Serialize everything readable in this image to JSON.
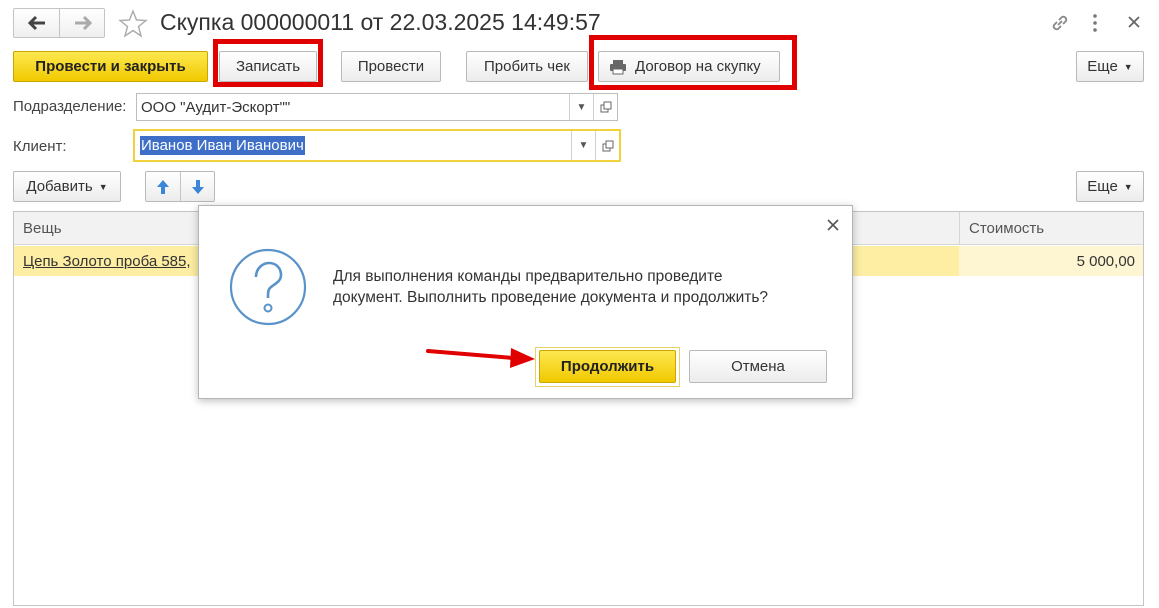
{
  "window": {
    "title": "Скупка 000000011 от 22.03.2025 14:49:57"
  },
  "nav": {
    "back_icon": "arrow-left-icon",
    "forward_icon": "arrow-right-icon",
    "favorite_icon": "star-icon",
    "link_icon": "link-icon",
    "menu_icon": "more-vertical-icon",
    "close_icon": "close-icon"
  },
  "toolbar": {
    "post_close_label": "Провести и закрыть",
    "save_label": "Записать",
    "post_label": "Провести",
    "receipt_label": "Пробить чек",
    "contract_label": "Договор на скупку",
    "more_label": "Еще"
  },
  "form": {
    "division_label": "Подразделение:",
    "division_value": "ООО \"Аудит-Эскорт\"\"",
    "client_label": "Клиент:",
    "client_value": "Иванов Иван Иванович"
  },
  "table_toolbar": {
    "add_label": "Добавить",
    "more_label": "Еще"
  },
  "table": {
    "columns": [
      "Вещь",
      "Стоимость"
    ],
    "rows": [
      {
        "item": "Цепь Золото проба 585,",
        "cost": "5 000,00"
      }
    ]
  },
  "dialog": {
    "message_line1": "Для выполнения команды предварительно проведите",
    "message_line2": "документ. Выполнить проведение документа и продолжить?",
    "continue_label": "Продолжить",
    "cancel_label": "Отмена"
  },
  "colors": {
    "accent_yellow": "#f5d51b",
    "highlight_red": "#e00000",
    "selection_blue": "#3d6fc9",
    "row_highlight": "#fdeea3",
    "question_blue": "#5a93c9"
  }
}
